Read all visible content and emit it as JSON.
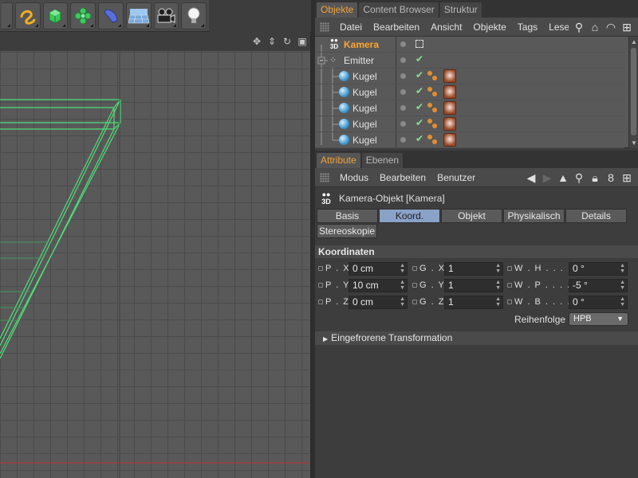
{
  "toolbar": {
    "icons": [
      "cube-tool-icon",
      "spline-pen-icon",
      "cube-primitive-icon",
      "cloner-icon",
      "deformer-icon",
      "floor-scene-icon",
      "camera-icon",
      "light-icon"
    ]
  },
  "viewport": {
    "nav_icons": [
      "move-view-icon",
      "dolly-view-icon",
      "rotate-view-icon",
      "maximize-view-icon"
    ],
    "colors": {
      "wireframe": "#4ee07a",
      "grid": "#4b4b4b",
      "background": "#595959"
    }
  },
  "object_manager": {
    "tabs": [
      "Objekte",
      "Content Browser",
      "Struktur"
    ],
    "menu": [
      "Datei",
      "Bearbeiten",
      "Ansicht",
      "Objekte",
      "Tags",
      "Lese"
    ],
    "objects": [
      {
        "name": "Kamera",
        "icon": "camera-3d-icon",
        "selected": true
      },
      {
        "name": "Emitter",
        "icon": "emitter-icon",
        "selected": false
      },
      {
        "name": "Kugel",
        "icon": "sphere-icon",
        "selected": false
      },
      {
        "name": "Kugel",
        "icon": "sphere-icon",
        "selected": false
      },
      {
        "name": "Kugel",
        "icon": "sphere-icon",
        "selected": false
      },
      {
        "name": "Kugel",
        "icon": "sphere-icon",
        "selected": false
      },
      {
        "name": "Kugel",
        "icon": "sphere-icon",
        "selected": false
      }
    ]
  },
  "attribute_manager": {
    "tabs": [
      "Attribute",
      "Ebenen"
    ],
    "menu": [
      "Modus",
      "Bearbeiten",
      "Benutzer"
    ],
    "title": "Kamera-Objekt [Kamera]",
    "property_tabs": [
      "Basis",
      "Koord.",
      "Objekt",
      "Physikalisch",
      "Details",
      "Stereoskopie"
    ],
    "active_tab": "Koord.",
    "section_title": "Koordinaten",
    "fields": {
      "px": {
        "label": "P . X",
        "value": "0 cm"
      },
      "py": {
        "label": "P . Y",
        "value": "10 cm"
      },
      "pz": {
        "label": "P . Z",
        "value": "0 cm"
      },
      "gx": {
        "label": "G . X",
        "value": "1"
      },
      "gy": {
        "label": "G . Y",
        "value": "1"
      },
      "gz": {
        "label": "G . Z",
        "value": "1"
      },
      "wh": {
        "label": "W . H . . . . . .",
        "value": "0 °"
      },
      "wp": {
        "label": "W . P . . . . . .",
        "value": "-5 °"
      },
      "wb": {
        "label": "W . B . . . . . .",
        "value": "0 °"
      }
    },
    "order_label": "Reihenfolge",
    "order_value": "HPB",
    "frozen_label": "Eingefrorene Transformation"
  }
}
